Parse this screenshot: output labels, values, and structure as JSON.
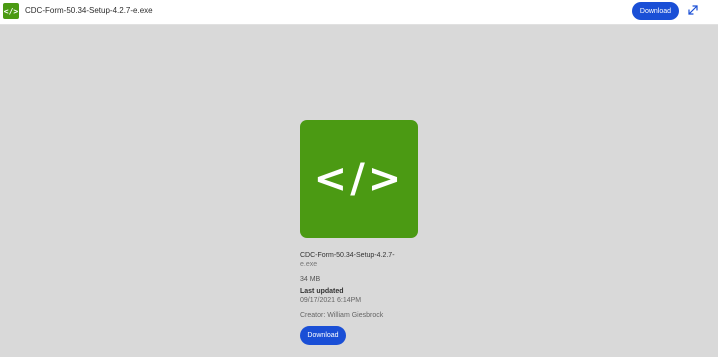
{
  "header": {
    "file_icon": "code-file-icon",
    "file_icon_text": "</>",
    "file_name": "CDC-Form-50.34-Setup-4.2.7-e.exe",
    "download_label": "Download",
    "expand_icon": "expand-icon"
  },
  "preview": {
    "icon": "code-icon",
    "icon_text": "</>",
    "color": "#4b9a13"
  },
  "details": {
    "name_line1": "CDC-Form-50.34-Setup-4.2.7-",
    "name_line2": "e.exe",
    "size": "34 MB",
    "last_updated_label": "Last updated",
    "last_updated_value": "09/17/2021 6:14PM",
    "creator": "Creator: William Giesbrock",
    "download_label": "Download"
  },
  "colors": {
    "accent": "#1a4fd6",
    "file_green": "#4b9a13",
    "background": "#d9d9d9"
  }
}
